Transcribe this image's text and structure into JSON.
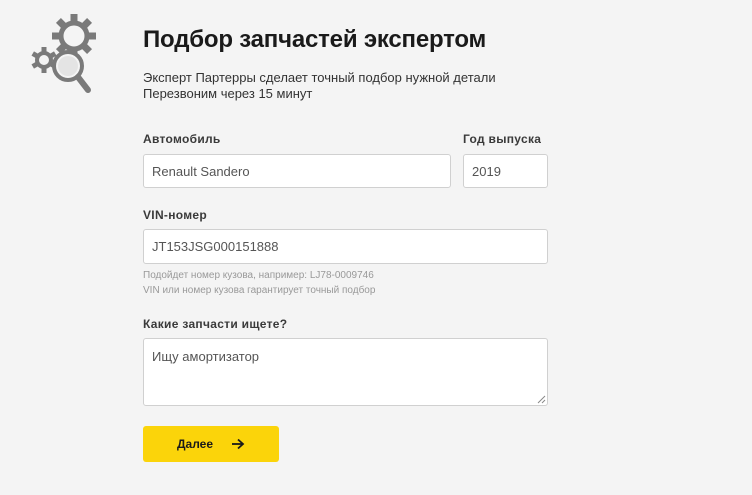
{
  "header": {
    "title": "Подбор запчастей экспертом",
    "subtitle_line1": "Эксперт Партерры сделает точный подбор нужной детали",
    "subtitle_line2": "Перезвоним через 15 минут",
    "logo_icon": "gears-magnifier-icon"
  },
  "form": {
    "car": {
      "label": "Автомобиль",
      "value": "Renault Sandero"
    },
    "year": {
      "label": "Год выпуска",
      "value": "2019"
    },
    "vin": {
      "label": "VIN-номер",
      "value": "JT153JSG000151888",
      "hint_line1": "Подойдет номер кузова, например: LJ78-0009746",
      "hint_line2": "VIN или номер кузова гарантирует точный подбор"
    },
    "parts": {
      "label": "Какие запчасти ищете?",
      "value": "Ищу амортизатор"
    },
    "submit": {
      "label": "Далее",
      "icon": "arrow-right-icon"
    }
  },
  "colors": {
    "background": "#f4f4f4",
    "accent": "#fbd40a",
    "field_border": "#d0d0d0",
    "icon_gray": "#7a7a7a"
  }
}
